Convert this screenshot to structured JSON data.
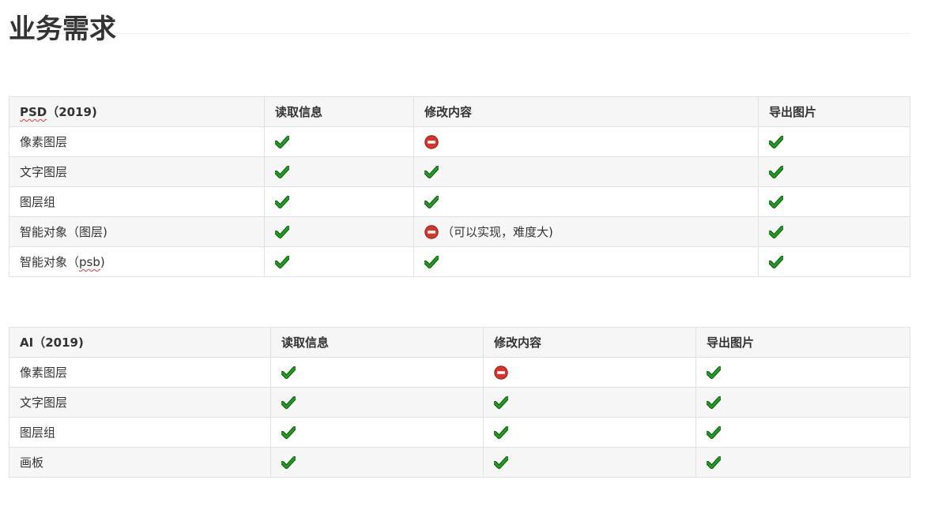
{
  "page_title": "业务需求",
  "colors": {
    "check_green": "#1f9e1f",
    "no_red": "#d9342b",
    "border": "#dfe2e5",
    "header_bg": "#f6f6f6"
  },
  "icons": {
    "yes": "check-mark-icon",
    "no": "no-entry-icon"
  },
  "tables": [
    {
      "header": {
        "c0_pre": "",
        "c0_squiggle": "PSD",
        "c0_post": "（2019)",
        "c1": "读取信息",
        "c2": "修改内容",
        "c3": "导出图片"
      },
      "rows": [
        {
          "label_pre": "像素图层",
          "label_squiggle": "",
          "label_post": "",
          "read": "yes",
          "modify": "no",
          "modify_note": "",
          "export": "yes"
        },
        {
          "label_pre": "文字图层",
          "label_squiggle": "",
          "label_post": "",
          "read": "yes",
          "modify": "yes",
          "modify_note": "",
          "export": "yes"
        },
        {
          "label_pre": "图层组",
          "label_squiggle": "",
          "label_post": "",
          "read": "yes",
          "modify": "yes",
          "modify_note": "",
          "export": "yes"
        },
        {
          "label_pre": "智能对象（图层)",
          "label_squiggle": "",
          "label_post": "",
          "read": "yes",
          "modify": "no",
          "modify_note": "（可以实现，难度大)",
          "export": "yes"
        },
        {
          "label_pre": "智能对象（",
          "label_squiggle": "psb",
          "label_post": ")",
          "read": "yes",
          "modify": "yes",
          "modify_note": "",
          "export": "yes"
        }
      ]
    },
    {
      "header": {
        "c0_pre": "AI（2019)",
        "c0_squiggle": "",
        "c0_post": "",
        "c1": "读取信息",
        "c2": "修改内容",
        "c3": "导出图片"
      },
      "rows": [
        {
          "label_pre": "像素图层",
          "label_squiggle": "",
          "label_post": "",
          "read": "yes",
          "modify": "no",
          "modify_note": "",
          "export": "yes"
        },
        {
          "label_pre": "文字图层",
          "label_squiggle": "",
          "label_post": "",
          "read": "yes",
          "modify": "yes",
          "modify_note": "",
          "export": "yes"
        },
        {
          "label_pre": "图层组",
          "label_squiggle": "",
          "label_post": "",
          "read": "yes",
          "modify": "yes",
          "modify_note": "",
          "export": "yes"
        },
        {
          "label_pre": "画板",
          "label_squiggle": "",
          "label_post": "",
          "read": "yes",
          "modify": "yes",
          "modify_note": "",
          "export": "yes"
        }
      ]
    }
  ]
}
